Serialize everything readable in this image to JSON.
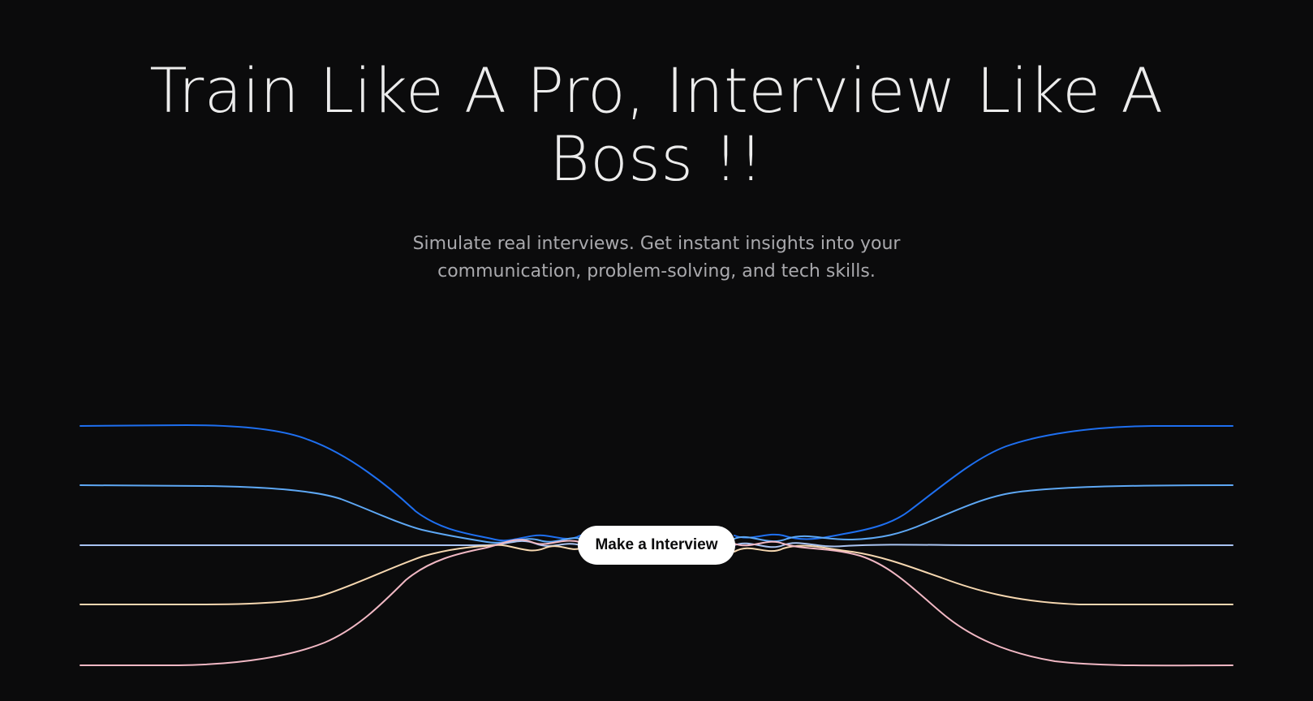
{
  "hero": {
    "title_line1": "Train Like A Pro, Interview Like A",
    "title_line2": "Boss !!",
    "subtitle_line1": "Simulate real interviews. Get instant insights into your",
    "subtitle_line2": "communication, problem-solving, and tech skills.",
    "cta_label": "Make a Interview"
  },
  "decoration": {
    "line_colors": [
      "#1e6ff0",
      "#5ea8f5",
      "#a9c4f2",
      "#f6d7b0",
      "#f1b8c4"
    ],
    "background": "#0b0b0c"
  }
}
